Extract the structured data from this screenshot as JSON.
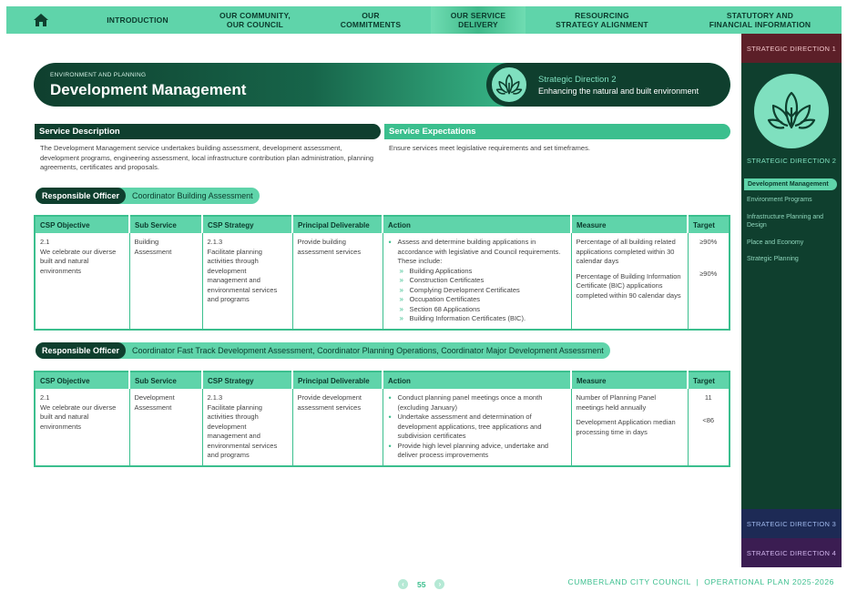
{
  "nav": {
    "items": [
      {
        "label": "INTRODUCTION"
      },
      {
        "label": "OUR COMMUNITY,\nOUR COUNCIL"
      },
      {
        "label": "OUR\nCOMMITMENTS"
      },
      {
        "label": "OUR SERVICE\nDELIVERY"
      },
      {
        "label": "RESOURCING\nSTRATEGY ALIGNMENT"
      },
      {
        "label": "STATUTORY AND\nFINANCIAL INFORMATION"
      }
    ]
  },
  "sidebar": {
    "sd1": "STRATEGIC DIRECTION 1",
    "sd2": "STRATEGIC DIRECTION 2",
    "items": [
      {
        "label": "Development Management"
      },
      {
        "label": "Environment Programs"
      },
      {
        "label": "Infrastructure Planning and Design"
      },
      {
        "label": "Place and Economy"
      },
      {
        "label": "Strategic Planning"
      }
    ],
    "sd3": "STRATEGIC DIRECTION 3",
    "sd4": "STRATEGIC DIRECTION 4"
  },
  "banner": {
    "category": "ENVIRONMENT AND PLANNING",
    "title": "Development Management",
    "direction": "Strategic Direction 2",
    "direction_sub": "Enhancing the natural and built environment"
  },
  "service_description": {
    "heading": "Service Description",
    "text": "The Development Management service undertakes building assessment, development assessment, development programs, engineering assessment, local infrastructure contribution plan administration, planning agreements, certificates and proposals."
  },
  "service_expectations": {
    "heading": "Service Expectations",
    "text": "Ensure services meet legislative requirements and set timeframes."
  },
  "table_headers": [
    "CSP Objective",
    "Sub Service",
    "CSP Strategy",
    "Principal Deliverable",
    "Action",
    "Measure",
    "Target"
  ],
  "officer1": {
    "label": "Responsible Officer",
    "value": "Coordinator Building Assessment"
  },
  "table1": {
    "objective": "2.1\nWe celebrate our diverse built and natural environments",
    "sub_service": "Building Assessment",
    "strategy": "2.1.3\nFacilitate planning activities through development management and environmental services and programs",
    "deliverable": "Provide building assessment services",
    "action_intro": "Assess and determine building applications in accordance with legislative and Council requirements. These include:",
    "action_items": [
      "Building Applications",
      "Construction Certificates",
      "Complying Development Certificates",
      "Occupation Certificates",
      "Section 68 Applications",
      "Building Information Certificates (BIC)."
    ],
    "measure1": "Percentage of all building related applications completed within 30 calendar days",
    "measure2": "Percentage of Building Information Certificate (BIC) applications completed within 90 calendar days",
    "target1": "≥90%",
    "target2": "≥90%"
  },
  "officer2": {
    "label": "Responsible Officer",
    "value": "Coordinator Fast Track Development Assessment, Coordinator Planning Operations, Coordinator Major Development Assessment"
  },
  "table2": {
    "objective": "2.1\nWe celebrate our diverse built and natural environments",
    "sub_service": "Development Assessment",
    "strategy": "2.1.3\nFacilitate planning activities through development management and environmental services and programs",
    "deliverable": "Provide development assessment services",
    "actions": [
      "Conduct planning panel meetings once a month (excluding January)",
      "Undertake assessment and determination of development applications, tree applications and subdivision certificates",
      "Provide high level planning advice, undertake and deliver process improvements"
    ],
    "measure1": "Number of Planning Panel meetings held annually",
    "measure2": "Development Application median processing time in days",
    "target1": "11",
    "target2": "<86"
  },
  "footer": {
    "page": "55",
    "org": "CUMBERLAND CITY COUNCIL  |  OPERATIONAL PLAN 2025-2026"
  },
  "colors": {
    "dark_green": "#0f3f2e",
    "accent": "#5fd4aa",
    "mid_green": "#3bbf8e"
  }
}
